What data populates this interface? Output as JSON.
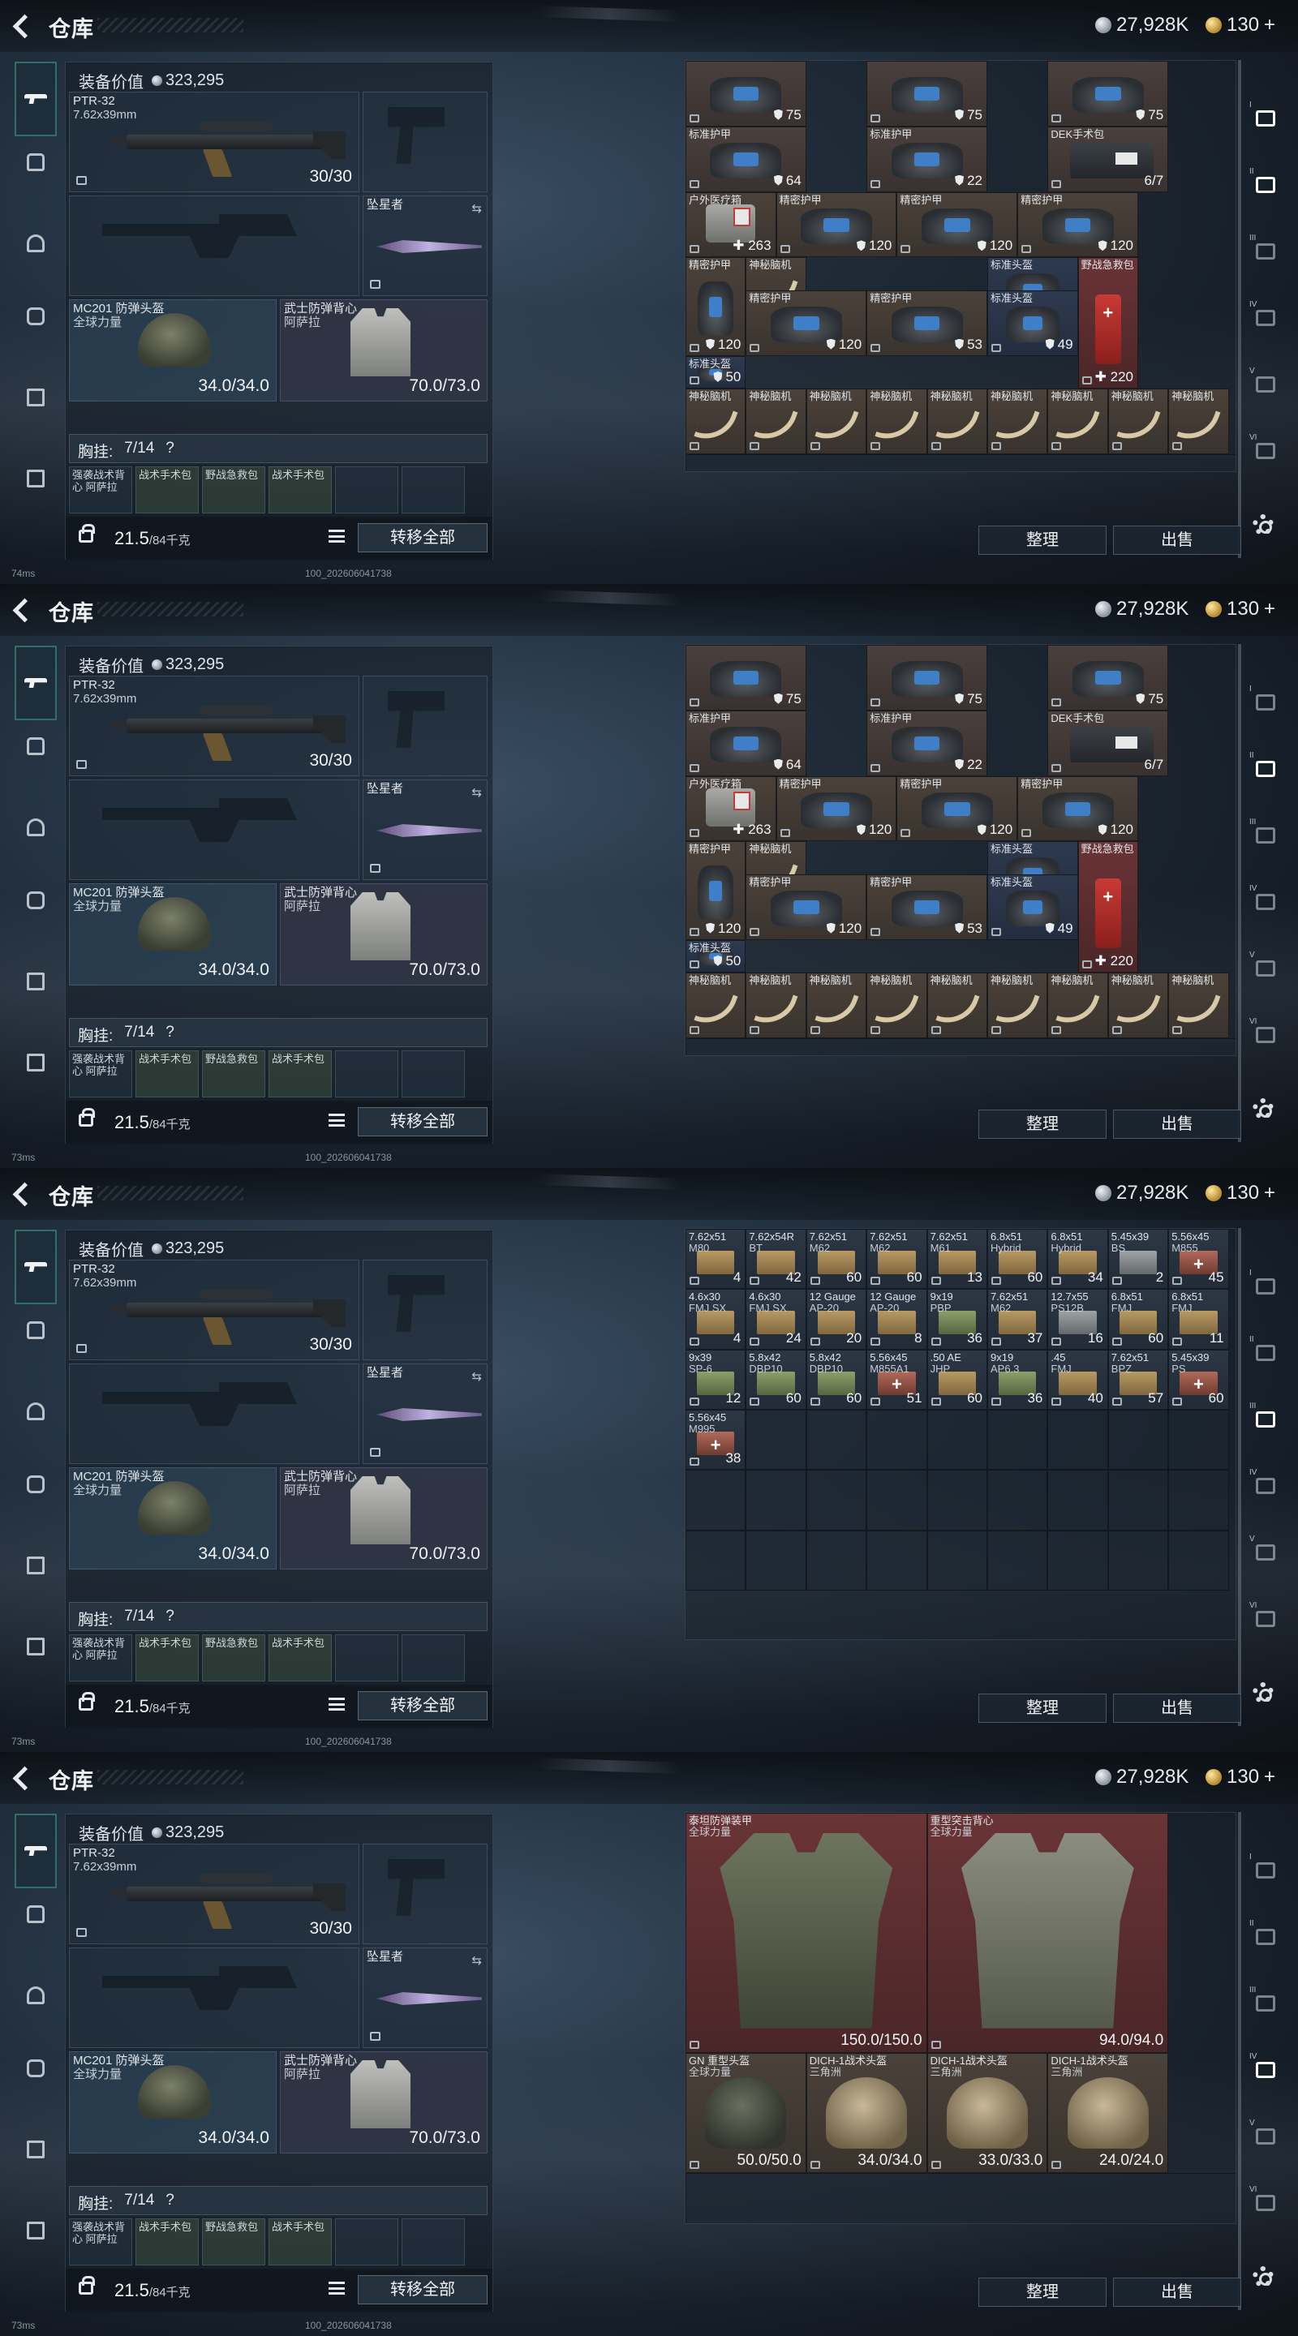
{
  "header": {
    "title": "仓库",
    "silver": "27,928K",
    "gold": "130",
    "gold_plus": "+"
  },
  "loadout": {
    "value_label": "装备价值",
    "value": "323,295",
    "primary": {
      "name": "PTR-32",
      "caliber": "7.62x39mm",
      "ammo": "30/30"
    },
    "melee": {
      "name": "坠星者"
    },
    "helmet": {
      "name": "MC201 防弹头盔",
      "sub": "全球力量",
      "durability": "34.0/34.0"
    },
    "vest": {
      "name": "武士防弹背心",
      "sub": "阿萨拉",
      "durability": "70.0/73.0"
    },
    "rig": {
      "label": "胸挂:",
      "slots": "7/14",
      "q": "?"
    },
    "rig_items": [
      "强袭战术背心 阿萨拉",
      "战术手术包",
      "野战急救包",
      "战术手术包"
    ],
    "weight": "21.5",
    "weight_max": "/84千克",
    "transfer_all": "转移全部"
  },
  "actions": {
    "sort": "整理",
    "sell": "出售"
  },
  "status": {
    "ping": "74ms",
    "ping2": "73ms",
    "build": "100_202606041738"
  },
  "rail_numerals": [
    "I",
    "II",
    "III",
    "IV",
    "V",
    "VI"
  ],
  "screens": [
    {
      "cells": [
        {
          "type": "armor",
          "img": "armor",
          "val": "75",
          "shield": true
        },
        {
          "type": "armor",
          "img": "armor",
          "val": "75",
          "shield": true
        },
        {
          "type": "armor",
          "img": "armor",
          "val": "75",
          "shield": true
        },
        {
          "type": "armor",
          "img": "armor",
          "name": "标准护甲",
          "val": "64",
          "shield": true
        },
        {
          "type": "armor",
          "img": "armor",
          "name": "标准护甲",
          "val": "22",
          "shield": true
        },
        {
          "type": "armor",
          "img": "medkit",
          "name": "DEK手术包",
          "val": "6/7"
        },
        {
          "type": "med",
          "img": "bag",
          "name": "户外医疗箱",
          "val": "263",
          "plus": true
        },
        {
          "type": "med",
          "img": "armor",
          "name": "精密护甲",
          "val": "120",
          "shield": true
        },
        {
          "type": "med",
          "img": "armor",
          "name": "精密护甲",
          "val": "120",
          "shield": true
        },
        {
          "type": "med",
          "img": "armor",
          "name": "精密护甲",
          "val": "120",
          "shield": true
        },
        {
          "type": "med",
          "img": "armor",
          "name": "精密护甲",
          "val": "120",
          "shield": true
        },
        {
          "type": "med",
          "img": "syringe",
          "name": "神秘脑机"
        },
        {
          "type": "med",
          "img": "armor",
          "name": "精密护甲",
          "val": "120",
          "shield": true
        },
        {
          "type": "med",
          "img": "armor",
          "name": "精密护甲",
          "val": "53",
          "shield": true
        },
        {
          "type": "blue",
          "img": "armor",
          "name": "标准头盔",
          "val": "50",
          "shield": true
        },
        {
          "type": "blue",
          "img": "armor",
          "name": "标准头盔",
          "val": "49",
          "shield": true
        },
        {
          "type": "red",
          "img": "red",
          "name": "野战急救包",
          "val": "220",
          "plus": true
        },
        {
          "type": "blue",
          "img": "armor",
          "name": "标准头盔",
          "val": "50",
          "shield": true
        },
        {
          "type": "med",
          "img": "syringe",
          "name": "神秘脑机"
        },
        {
          "type": "med",
          "img": "syringe",
          "name": "神秘脑机"
        },
        {
          "type": "med",
          "img": "syringe",
          "name": "神秘脑机"
        },
        {
          "type": "med",
          "img": "syringe",
          "name": "神秘脑机"
        },
        {
          "type": "med",
          "img": "syringe",
          "name": "神秘脑机"
        },
        {
          "type": "med",
          "img": "syringe",
          "name": "神秘脑机"
        },
        {
          "type": "med",
          "img": "syringe",
          "name": "神秘脑机"
        },
        {
          "type": "med",
          "img": "syringe",
          "name": "神秘脑机"
        },
        {
          "type": "med",
          "img": "syringe",
          "name": "神秘脑机"
        }
      ]
    },
    {
      "cells": [
        {
          "type": "ammo",
          "img": "ammo",
          "name": "7.62x51",
          "sub": "M80",
          "val": "4"
        },
        {
          "type": "ammo",
          "img": "ammo",
          "name": "7.62x54R",
          "sub": "BT",
          "val": "42"
        },
        {
          "type": "ammo",
          "img": "ammo",
          "name": "7.62x51",
          "sub": "M62",
          "val": "60"
        },
        {
          "type": "ammo",
          "img": "ammo",
          "name": "7.62x51",
          "sub": "M62",
          "val": "60"
        },
        {
          "type": "ammo",
          "img": "ammo",
          "name": "7.62x51",
          "sub": "M61",
          "val": "13"
        },
        {
          "type": "ammo",
          "img": "ammo",
          "name": "6.8x51",
          "sub": "Hybrid",
          "val": "60"
        },
        {
          "type": "ammo",
          "img": "ammo",
          "name": "6.8x51",
          "sub": "Hybrid",
          "val": "34"
        },
        {
          "type": "ammo",
          "img": "ammo grey",
          "name": "5.45x39",
          "sub": "BS",
          "val": "2"
        },
        {
          "type": "ammo",
          "img": "ammo red",
          "name": "5.56x45",
          "sub": "M855",
          "val": "45"
        },
        {
          "type": "ammo",
          "img": "ammo",
          "name": "4.6x30",
          "sub": "FMJ SX",
          "val": "4"
        },
        {
          "type": "ammo",
          "img": "ammo",
          "name": "4.6x30",
          "sub": "FMJ SX",
          "val": "24"
        },
        {
          "type": "ammo",
          "img": "ammo",
          "name": "12 Gauge",
          "sub": "AP-20",
          "val": "20"
        },
        {
          "type": "ammo",
          "img": "ammo",
          "name": "12 Gauge",
          "sub": "AP-20",
          "val": "8"
        },
        {
          "type": "ammo",
          "img": "ammo green",
          "name": "9x19",
          "sub": "PBP",
          "val": "36"
        },
        {
          "type": "ammo",
          "img": "ammo",
          "name": "7.62x51",
          "sub": "M62",
          "val": "37"
        },
        {
          "type": "ammo",
          "img": "ammo grey",
          "name": "12.7x55",
          "sub": "PS12B",
          "val": "16"
        },
        {
          "type": "ammo",
          "img": "ammo",
          "name": "6.8x51",
          "sub": "FMJ",
          "val": "60"
        },
        {
          "type": "ammo",
          "img": "ammo",
          "name": "6.8x51",
          "sub": "FMJ",
          "val": "11"
        },
        {
          "type": "ammo",
          "img": "ammo green",
          "name": "9x39",
          "sub": "SP-6",
          "val": "12"
        },
        {
          "type": "ammo",
          "img": "ammo green",
          "name": "5.8x42",
          "sub": "DBP10",
          "val": "60"
        },
        {
          "type": "ammo",
          "img": "ammo green",
          "name": "5.8x42",
          "sub": "DBP10",
          "val": "60"
        },
        {
          "type": "ammo",
          "img": "ammo red",
          "name": "5.56x45",
          "sub": "M855A1",
          "val": "51"
        },
        {
          "type": "ammo",
          "img": "ammo",
          "name": ".50 AE",
          "sub": "JHP",
          "val": "60"
        },
        {
          "type": "ammo",
          "img": "ammo green",
          "name": "9x19",
          "sub": "AP6.3",
          "val": "36"
        },
        {
          "type": "ammo",
          "img": "ammo",
          "name": ".45",
          "sub": "FMJ",
          "val": "40"
        },
        {
          "type": "ammo",
          "img": "ammo",
          "name": "7.62x51",
          "sub": "BPZ",
          "val": "57"
        },
        {
          "type": "ammo",
          "img": "ammo red",
          "name": "5.45x39",
          "sub": "PS",
          "val": "60"
        },
        {
          "type": "ammo",
          "img": "ammo red",
          "name": "5.56x45",
          "sub": "M995",
          "val": "38"
        }
      ]
    },
    {
      "cells": [
        {
          "type": "red",
          "img": "bigvest",
          "name": "泰坦防弹装甲",
          "sub": "全球力量",
          "val": "150.0/150.0"
        },
        {
          "type": "red",
          "img": "bigvest camo",
          "name": "重型突击背心",
          "sub": "全球力量",
          "val": "94.0/94.0"
        },
        {
          "type": "med",
          "img": "helmet2 dark",
          "name": "GN 重型头盔",
          "sub": "全球力量",
          "val": "50.0/50.0"
        },
        {
          "type": "med",
          "img": "helmet2",
          "name": "DICH-1战术头盔",
          "sub": "三角洲",
          "val": "34.0/34.0"
        },
        {
          "type": "med",
          "img": "helmet2",
          "name": "DICH-1战术头盔",
          "sub": "三角洲",
          "val": "33.0/33.0"
        },
        {
          "type": "med",
          "img": "helmet2",
          "name": "DICH-1战术头盔",
          "sub": "三角洲",
          "val": "24.0/24.0"
        }
      ]
    }
  ]
}
